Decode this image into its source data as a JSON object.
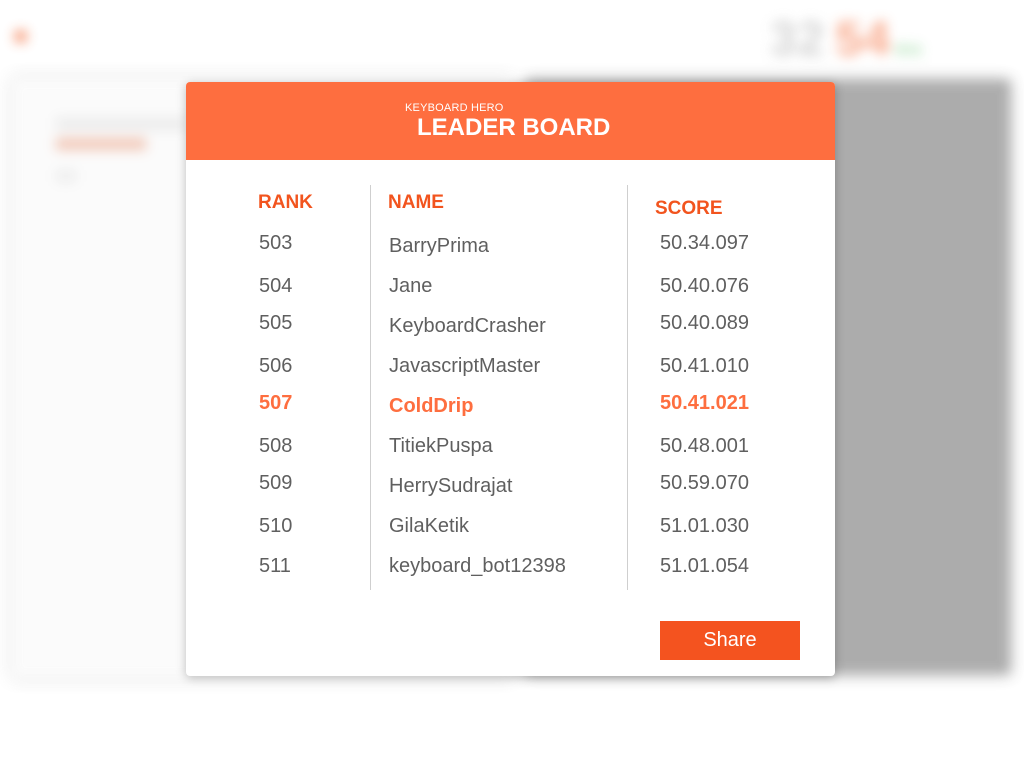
{
  "modal": {
    "subtitle": "KEYBOARD HERO",
    "title": "LEADER BOARD",
    "columns": {
      "rank": "RANK",
      "name": "NAME",
      "score": "SCORE"
    },
    "rows": [
      {
        "rank": "503",
        "name": "BarryPrima",
        "score": "50.34.097"
      },
      {
        "rank": "504",
        "name": "Jane",
        "score": "50.40.076"
      },
      {
        "rank": "505",
        "name": "KeyboardCrasher",
        "score": "50.40.089"
      },
      {
        "rank": "506",
        "name": "JavascriptMaster",
        "score": "50.41.010"
      },
      {
        "rank": "507",
        "name": "ColdDrip",
        "score": "50.41.021"
      },
      {
        "rank": "508",
        "name": "TitiekPuspa",
        "score": "50.48.001"
      },
      {
        "rank": "509",
        "name": "HerrySudrajat",
        "score": "50.59.070"
      },
      {
        "rank": "510",
        "name": "GilaKetik",
        "score": "51.01.030"
      },
      {
        "rank": "511",
        "name": "keyboard_bot12398",
        "score": "51.01.054"
      }
    ],
    "highlighted_rank": "507",
    "share_label": "Share"
  },
  "background": {
    "timer_minutes": "32",
    "timer_seconds": "54",
    "timer_ms": "ms"
  },
  "colors": {
    "accent": "#fe6e3f",
    "header_text": "#f2541e",
    "button": "#f4531f",
    "row_text": "#5f5f5f",
    "overlay_panel": "#a4a4a4"
  }
}
